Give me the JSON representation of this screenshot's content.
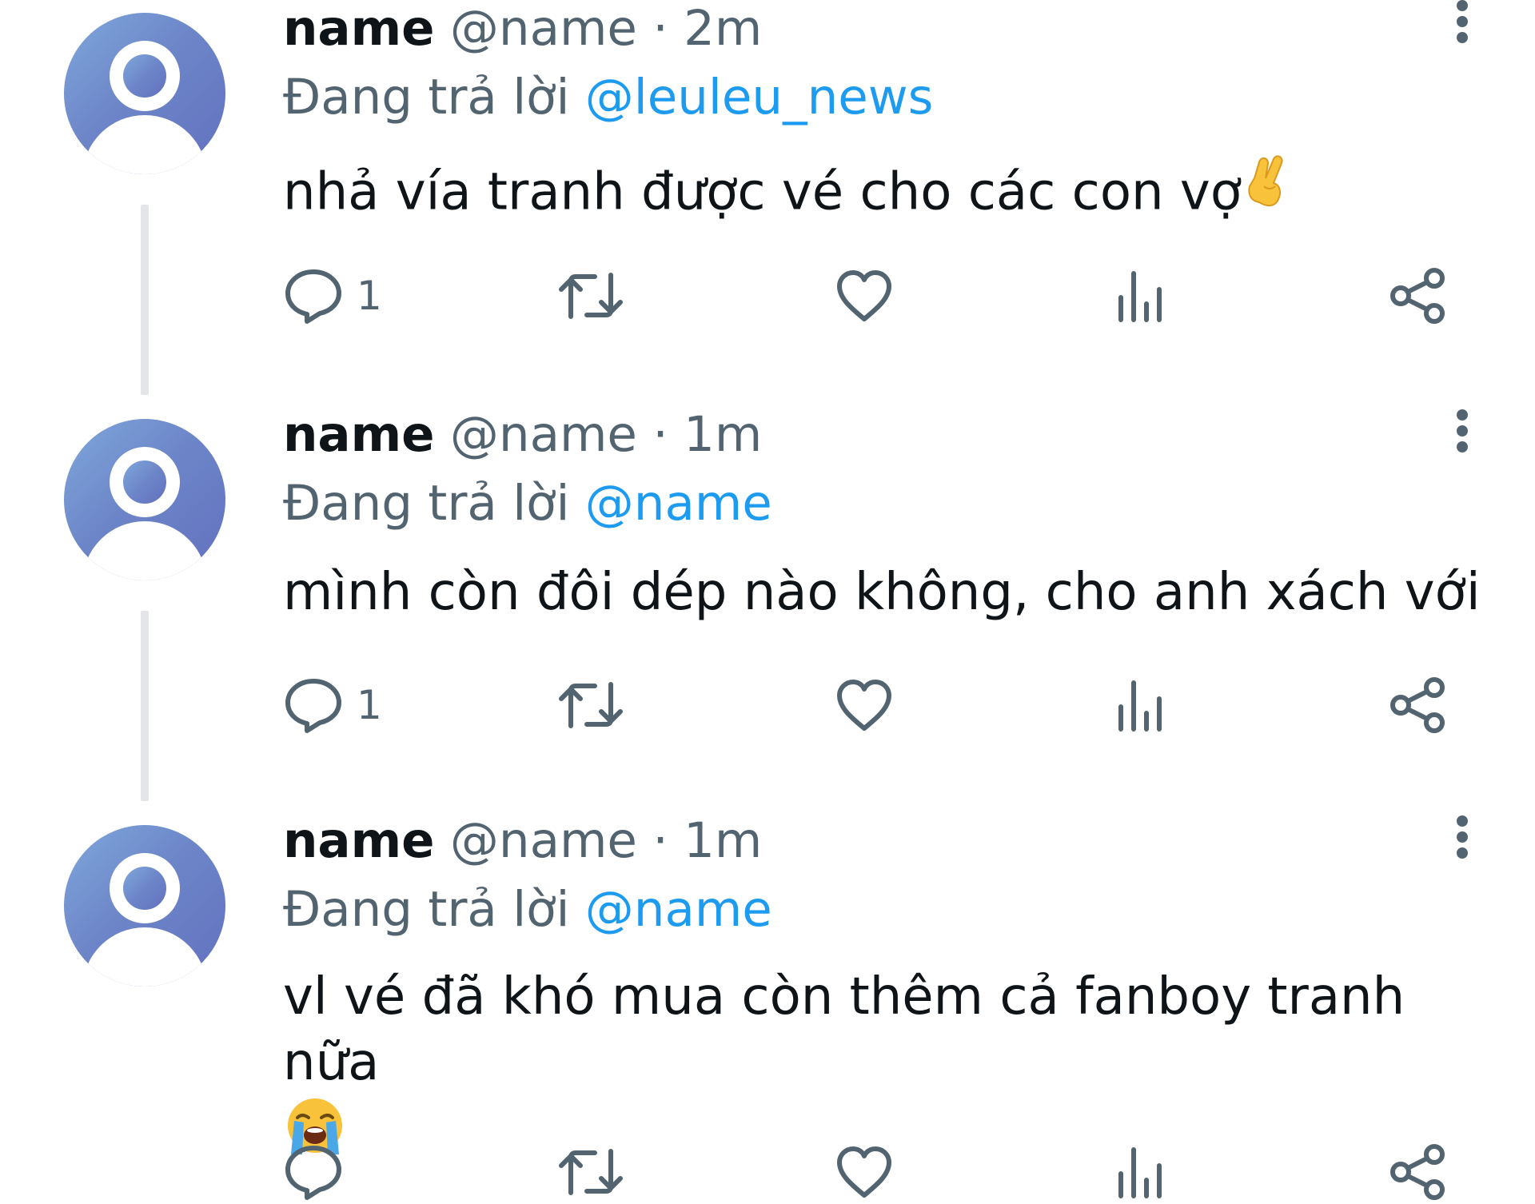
{
  "colors": {
    "text": "#0f1419",
    "secondary": "#536471",
    "accent": "#1d9bf0",
    "thread_line": "#e3e5e8",
    "avatar": "#6d86c8"
  },
  "tweets": [
    {
      "name": "name",
      "handle": "@name",
      "dot": "·",
      "time": "2m",
      "replying_label": "Đang trả lời",
      "mention": "@leuleu_news",
      "text": "nhả vía tranh được vé cho các con vợ",
      "emoji": "crossed-fingers",
      "reply_count": "1"
    },
    {
      "name": "name",
      "handle": "@name",
      "dot": "·",
      "time": "1m",
      "replying_label": "Đang trả lời",
      "mention": "@name",
      "text": "mình còn đôi dép nào không, cho anh xách với",
      "reply_count": "1"
    },
    {
      "name": "name",
      "handle": "@name",
      "dot": "·",
      "time": "1m",
      "replying_label": "Đang trả lời",
      "mention": "@name",
      "text": "vl vé đã khó mua còn thêm cả fanboy tranh nữa",
      "emoji": "loudly-crying-face",
      "reply_count": ""
    }
  ],
  "icons": {
    "reply": "reply-icon",
    "retweet": "retweet-icon",
    "like": "heart-icon",
    "views": "views-icon",
    "share": "share-icon",
    "more": "more-options-icon"
  }
}
